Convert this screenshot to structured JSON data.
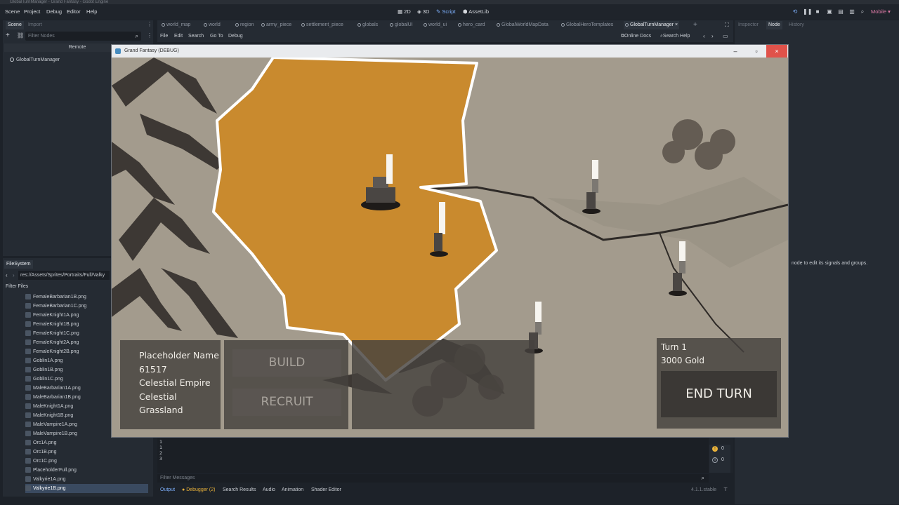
{
  "window_title": "GlobalTurnManager - Grand Fantasy - Godot Engine",
  "menu": [
    "Scene",
    "Project",
    "Debug",
    "Editor",
    "Help"
  ],
  "workspaces": [
    {
      "label": "2D",
      "icon": "2d-icon"
    },
    {
      "label": "3D",
      "icon": "3d-icon"
    },
    {
      "label": "Script",
      "icon": "script-icon"
    },
    {
      "label": "AssetLib",
      "icon": "assetlib-icon"
    }
  ],
  "renderer": "Mobile",
  "scene_dock": {
    "tabs": [
      "Scene",
      "Import"
    ],
    "filter_placeholder": "Filter Nodes",
    "remote_label": "Remote",
    "root_node": "GlobalTurnManager"
  },
  "filesystem": {
    "tab": "FileSystem",
    "path": "res://Assets/Sprites/Portraits/Full/Valky",
    "filter_label": "Filter Files",
    "files": [
      "FemaleBarbarian1B.png",
      "FemaleBarbarian1C.png",
      "FemaleKnight1A.png",
      "FemaleKnight1B.png",
      "FemaleKnight1C.png",
      "FemaleKnight2A.png",
      "FemaleKnight2B.png",
      "Goblin1A.png",
      "Goblin1B.png",
      "Goblin1C.png",
      "MaleBarbarian1A.png",
      "MaleBarbarian1B.png",
      "MaleKnight1A.png",
      "MaleKnight1B.png",
      "MaleVampire1A.png",
      "MaleVampire1B.png",
      "Orc1A.png",
      "Orc1B.png",
      "Orc1C.png",
      "PlaceholderFull.png",
      "Valkyrie1A.png",
      "Valkyrie1B.png"
    ],
    "selected": "Valkyrie1B.png"
  },
  "script_tabs": [
    "world_map",
    "world",
    "region",
    "army_piece",
    "settlement_piece",
    "globals",
    "globalUI",
    "world_ui",
    "hero_card",
    "GlobalWorldMapData",
    "GlobalHeroTemplates",
    "GlobalTurnManager"
  ],
  "active_script_tab": "GlobalTurnManager",
  "script_menu": [
    "File",
    "Edit",
    "Search",
    "Go To",
    "Debug"
  ],
  "script_help": [
    "Online Docs",
    "Search Help"
  ],
  "right_dock": {
    "tabs": [
      "Inspector",
      "Node",
      "History"
    ],
    "hint": "node to edit its signals and groups."
  },
  "game_window": {
    "title": "Grand Fantasy (DEBUG)",
    "hud": {
      "name": "Placeholder Name",
      "id": "61517",
      "faction": "Celestial Empire",
      "race": "Celestial",
      "terrain": "Grassland"
    },
    "buttons": {
      "build": "BUILD",
      "recruit": "RECRUIT"
    },
    "turn": "Turn 1",
    "gold": "3000 Gold",
    "end_turn": "END TURN"
  },
  "output": {
    "lines": [
      "1",
      "1",
      "2",
      "3"
    ],
    "filter_placeholder": "Filter Messages",
    "counts": [
      "0",
      "0"
    ],
    "version": "4.1.1.stable"
  },
  "bottom_tabs": [
    "Output",
    "Debugger (2)",
    "Search Results",
    "Audio",
    "Animation",
    "Shader Editor"
  ],
  "colors": {
    "editor_bg": "#1d2229",
    "accent": "#7fb2ff",
    "territory": "#c98a2e",
    "map_ground": "#a39b8d"
  }
}
